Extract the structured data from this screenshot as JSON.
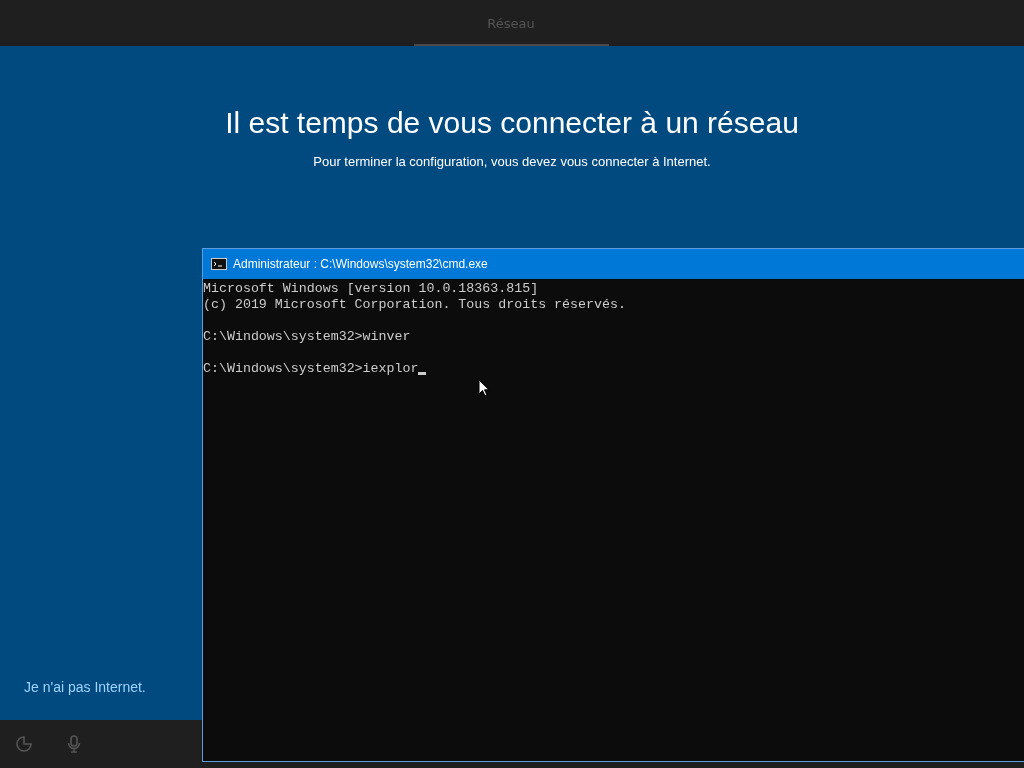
{
  "top_bar": {
    "tabs": [
      {
        "label": "Réseau",
        "selected": true
      }
    ]
  },
  "heading": "Il est temps de vous connecter à un réseau",
  "subtitle": "Pour terminer la configuration, vous devez vous connecter à Internet.",
  "no_internet_link": "Je n'ai pas Internet.",
  "console_window": {
    "title": "Administrateur : C:\\Windows\\system32\\cmd.exe",
    "blocks": [
      [
        "Microsoft Windows [version 10.0.18363.815]",
        "(c) 2019 Microsoft Corporation. Tous droits réservés."
      ],
      [
        "C:\\Windows\\system32>winver"
      ],
      [
        "C:\\Windows\\system32>iexplor"
      ]
    ],
    "caret": true
  }
}
